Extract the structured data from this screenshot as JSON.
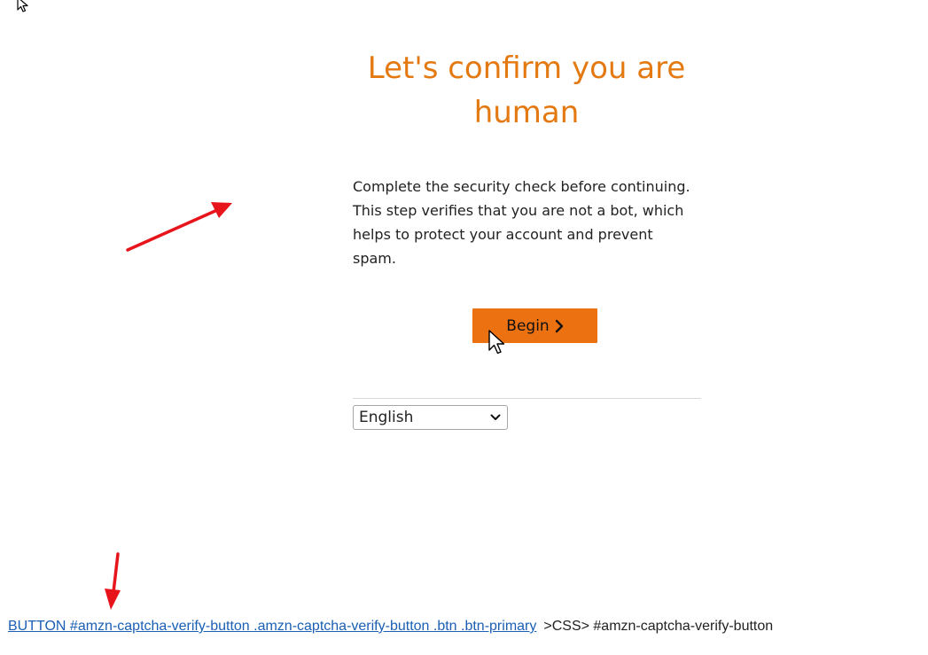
{
  "heading": "Let's confirm you are human",
  "description": "Complete the security check before continuing. This step verifies that you are not a bot, which helps to protect your account and prevent spam.",
  "begin_button": {
    "label": "Begin",
    "icon": "chevron-right-icon"
  },
  "language_select": {
    "selected": "English",
    "icon": "chevron-down-icon"
  },
  "footer": {
    "selector_link": "BUTTON #amzn-captcha-verify-button .amzn-captcha-verify-button .btn .btn-primary",
    "css_selector": ">CSS> #amzn-captcha-verify-button"
  },
  "colors": {
    "heading": "#e47911",
    "button": "#ec7211",
    "arrow": "#e8141b",
    "link": "#1a5fb4"
  }
}
